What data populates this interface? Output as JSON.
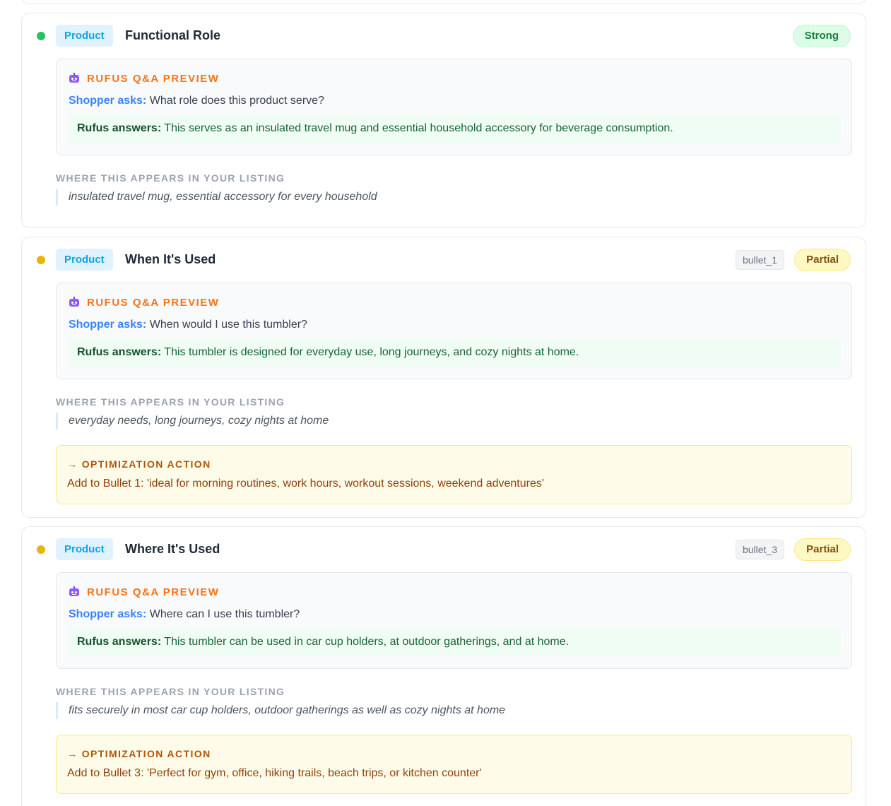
{
  "cards": [
    {
      "category": "Product",
      "title": "Functional Role",
      "status": "Strong",
      "source": "",
      "qa_title": "RUFUS Q&A PREVIEW",
      "shopper_label": "Shopper asks:",
      "question": "What role does this product serve?",
      "rufus_label": "Rufus answers:",
      "answer": "This serves as an insulated travel mug and essential household accessory for beverage consumption.",
      "where_label": "WHERE THIS APPEARS IN YOUR LISTING",
      "where_text": "insulated travel mug, essential accessory for every household",
      "opt_title": "",
      "opt_text": ""
    },
    {
      "category": "Product",
      "title": "When It's Used",
      "status": "Partial",
      "source": "bullet_1",
      "qa_title": "RUFUS Q&A PREVIEW",
      "shopper_label": "Shopper asks:",
      "question": "When would I use this tumbler?",
      "rufus_label": "Rufus answers:",
      "answer": "This tumbler is designed for everyday use, long journeys, and cozy nights at home.",
      "where_label": "WHERE THIS APPEARS IN YOUR LISTING",
      "where_text": "everyday needs, long journeys, cozy nights at home",
      "opt_title": "→ OPTIMIZATION ACTION",
      "opt_text": "Add to Bullet 1: 'ideal for morning routines, work hours, workout sessions, weekend adventures'"
    },
    {
      "category": "Product",
      "title": "Where It's Used",
      "status": "Partial",
      "source": "bullet_3",
      "qa_title": "RUFUS Q&A PREVIEW",
      "shopper_label": "Shopper asks:",
      "question": "Where can I use this tumbler?",
      "rufus_label": "Rufus answers:",
      "answer": "This tumbler can be used in car cup holders, at outdoor gatherings, and at home.",
      "where_label": "WHERE THIS APPEARS IN YOUR LISTING",
      "where_text": "fits securely in most car cup holders, outdoor gatherings as well as cozy nights at home",
      "opt_title": "→ OPTIMIZATION ACTION",
      "opt_text": "Add to Bullet 3: 'Perfect for gym, office, hiking trails, beach trips, or kitchen counter'"
    }
  ],
  "colors": {
    "strong": "#22c55e",
    "partial": "#eab308",
    "accent_orange": "#f97316",
    "shopper_blue": "#3b82f6"
  }
}
